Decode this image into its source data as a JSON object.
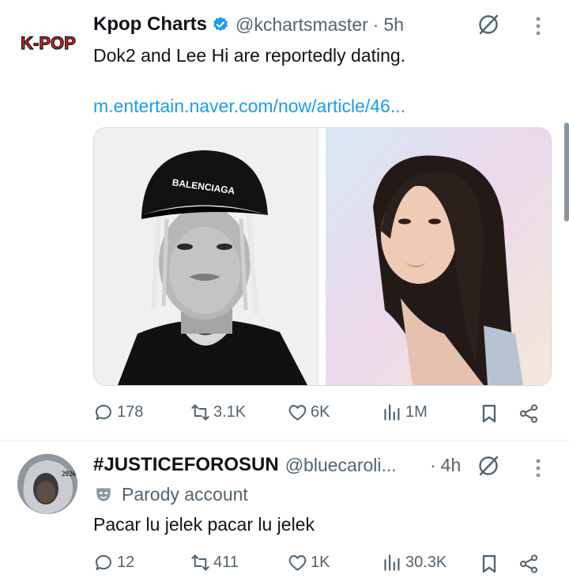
{
  "tweet1": {
    "avatar_text": "K-POP",
    "display_name": "Kpop Charts",
    "verified": true,
    "handle": "@kchartsmaster",
    "separator": "·",
    "time": "5h",
    "text": "Dok2 and Lee Hi are reportedly dating.",
    "link": "m.entertain.naver.com/now/article/46...",
    "media": [
      {
        "icon": "photo-portrait-man-black-cap",
        "cap_text": "BALENCIAGA"
      },
      {
        "icon": "photo-portrait-woman-dark-hair"
      }
    ],
    "actions": {
      "replies": "178",
      "reposts": "3.1K",
      "likes": "6K",
      "views": "1M"
    }
  },
  "tweet2": {
    "avatar_text": "2026",
    "display_name": "#JUSTICEFOROSUN",
    "handle": "@bluecaroli...",
    "separator": "·",
    "time": "4h",
    "label_icon": "parody-mask-icon",
    "label": "Parody account",
    "text": "Pacar lu jelek pacar lu jelek",
    "actions": {
      "replies": "12",
      "reposts": "411",
      "likes": "1K",
      "views": "30.3K"
    }
  },
  "colors": {
    "accent": "#1d9bf0",
    "muted": "#536471",
    "text": "#0f1419",
    "kpop_red": "#e3242b"
  }
}
